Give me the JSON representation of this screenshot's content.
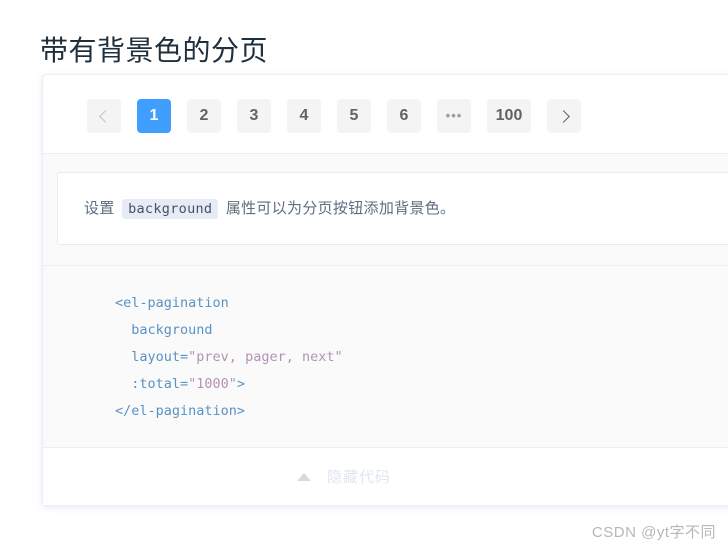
{
  "page": {
    "title": "带有背景色的分页"
  },
  "pagination": {
    "prev_icon": "chevron-left-icon",
    "next_icon": "chevron-right-icon",
    "active_page": "1",
    "items": [
      {
        "label": "1",
        "type": "page",
        "active": true
      },
      {
        "label": "2",
        "type": "page",
        "active": false
      },
      {
        "label": "3",
        "type": "page",
        "active": false
      },
      {
        "label": "4",
        "type": "page",
        "active": false
      },
      {
        "label": "5",
        "type": "page",
        "active": false
      },
      {
        "label": "6",
        "type": "page",
        "active": false
      },
      {
        "label": "•••",
        "type": "more",
        "active": false
      },
      {
        "label": "100",
        "type": "page",
        "active": false
      }
    ],
    "colors": {
      "active_bg": "#409eff",
      "inactive_bg": "#f4f4f5",
      "text": "#606266"
    }
  },
  "tip": {
    "prefix": "设置",
    "code": "background",
    "suffix": "属性可以为分页按钮添加背景色。",
    "code_bg": "#e6ebf5"
  },
  "code": {
    "line1_tag": "<el-pagination",
    "line2_attr": "background",
    "line3_attr": "layout=",
    "line3_value": "\"prev, pager, next\"",
    "line4_attr": ":total=",
    "line4_value": "\"1000\"",
    "line4_close": ">",
    "line5_tag": "</el-pagination>"
  },
  "hide_code": {
    "label": "隐藏代码",
    "caret_icon": "caret-up-icon"
  },
  "watermark": {
    "text": "CSDN @yt字不同"
  }
}
